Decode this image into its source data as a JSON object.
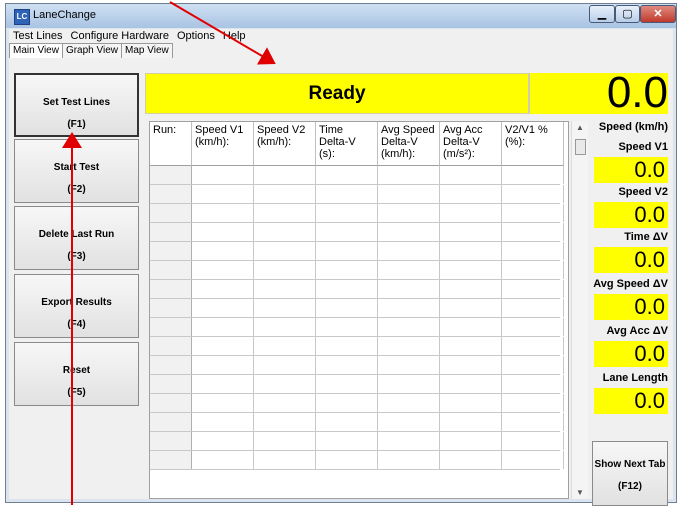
{
  "window": {
    "title": "LaneChange",
    "icon_glyph": "LC"
  },
  "menu": [
    "Test Lines",
    "Configure Hardware",
    "Options",
    "Help"
  ],
  "tabs": [
    "Main View",
    "Graph View",
    "Map View"
  ],
  "buttons": [
    {
      "label": "Set Test Lines",
      "key": "(F1)"
    },
    {
      "label": "Start Test",
      "key": "(F2)"
    },
    {
      "label": "Delete Last Run",
      "key": "(F3)"
    },
    {
      "label": "Export Results",
      "key": "(F4)"
    },
    {
      "label": "Reset",
      "key": "(F5)"
    }
  ],
  "status": "Ready",
  "speed_display": "0.0",
  "grid": {
    "columns": [
      {
        "line1": "Run:",
        "line2": "",
        "line3": ""
      },
      {
        "line1": "Speed V1",
        "line2": "(km/h):",
        "line3": ""
      },
      {
        "line1": "Speed V2",
        "line2": "(km/h):",
        "line3": ""
      },
      {
        "line1": "Time",
        "line2": "Delta-V (s):",
        "line3": ""
      },
      {
        "line1": "Avg Speed",
        "line2": "Delta-V",
        "line3": "(km/h):"
      },
      {
        "line1": "Avg Acc",
        "line2": "Delta-V",
        "line3": "(m/s²):"
      },
      {
        "line1": "V2/V1 %",
        "line2": "(%):",
        "line3": ""
      }
    ],
    "rows": 16
  },
  "readouts": {
    "speed_unit": "Speed (km/h)",
    "items": [
      {
        "label": "Speed V1",
        "value": "0.0"
      },
      {
        "label": "Speed V2",
        "value": "0.0"
      },
      {
        "label": "Time ΔV",
        "value": "0.0"
      },
      {
        "label": "Avg Speed ΔV",
        "value": "0.0"
      },
      {
        "label": "Avg Acc ΔV",
        "value": "0.0"
      },
      {
        "label": "Lane Length",
        "value": "0.0"
      }
    ]
  },
  "next_tab": {
    "label": "Show Next Tab",
    "key": "(F12)"
  },
  "colors": {
    "display": "#ffff00",
    "annotation": "#e00000"
  }
}
